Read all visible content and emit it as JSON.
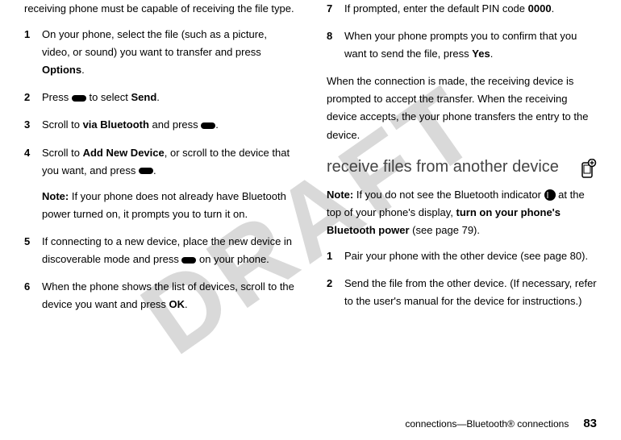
{
  "watermark": "DRAFT",
  "left": {
    "intro": "receiving phone must be capable of receiving the file type.",
    "steps": [
      {
        "n": "1",
        "pre": "On your phone, select the file (such as a picture, video, or sound) you want to transfer and press ",
        "bold": "Options",
        "post": "."
      },
      {
        "n": "2",
        "pre": "Press ",
        "icon": "pill",
        "mid": " to select ",
        "bold": "Send",
        "post": "."
      },
      {
        "n": "3",
        "pre": "Scroll to ",
        "bold": "via Bluetooth",
        "mid": " and press ",
        "icon2": "pill",
        "post": "."
      },
      {
        "n": "4",
        "pre": "Scroll to ",
        "bold": "Add New Device",
        "mid": ", or scroll to the device that you want, and press ",
        "icon2": "pill",
        "post": ".",
        "note_label": "Note:",
        "note": " If your phone does not already have Bluetooth power turned on, it prompts you to turn it on."
      },
      {
        "n": "5",
        "pre": "If connecting to a new device, place the new device in discoverable mode and press ",
        "icon": "pill",
        "post": " on your phone."
      },
      {
        "n": "6",
        "pre": "When the phone shows the list of devices, scroll to the device you want and press ",
        "bold": "OK",
        "post": "."
      }
    ]
  },
  "right": {
    "steps_top": [
      {
        "n": "7",
        "pre": "If prompted, enter the default PIN code ",
        "bold": "0000",
        "post": "."
      },
      {
        "n": "8",
        "pre": "When your phone prompts you to confirm that you want to send the file, press ",
        "bold": "Yes",
        "post": "."
      }
    ],
    "after": "When the connection is made, the receiving device is prompted to accept the transfer. When the receiving device accepts, the your phone transfers the entry to the device.",
    "section_title": "receive files from another device",
    "note_label": "Note:",
    "note_pre": " If you do not see the Bluetooth indicator ",
    "note_mid": " at the top of your phone's display, ",
    "note_bold": "turn on your phone's Bluetooth power",
    "note_post": " (see page 79).",
    "steps_bottom": [
      {
        "n": "1",
        "text": "Pair your phone with the other device (see page 80)."
      },
      {
        "n": "2",
        "text": "Send the file from the other device. (If necessary, refer to the user's manual for the device for instructions.)"
      }
    ]
  },
  "footer": {
    "section": "connections—Bluetooth® connections",
    "page": "83"
  }
}
